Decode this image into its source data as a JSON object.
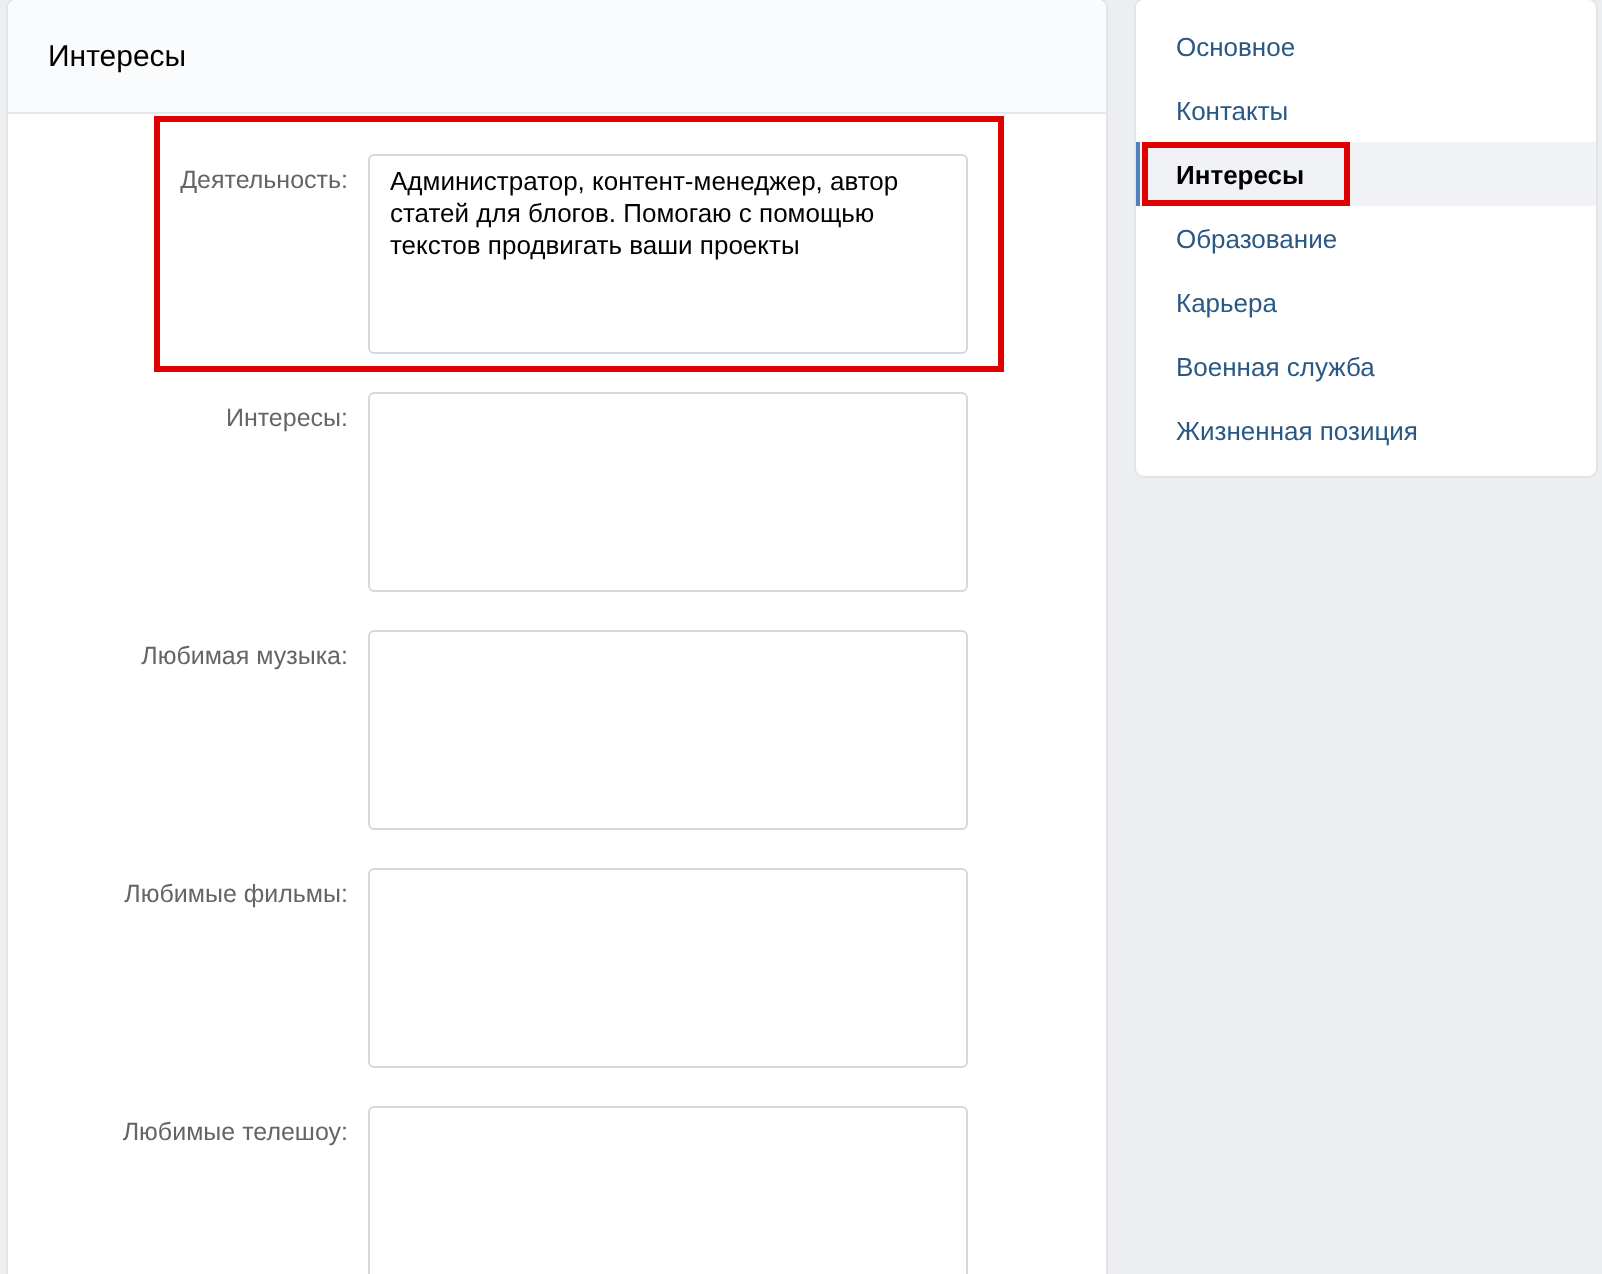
{
  "panel": {
    "title": "Интересы"
  },
  "fields": [
    {
      "label": "Деятельность:",
      "value": "Администратор, контент-менеджер, автор статей для блогов. Помогаю с помощью текстов продвигать ваши проекты",
      "highlighted": true
    },
    {
      "label": "Интересы:",
      "highlighted": false
    },
    {
      "label": "Любимая музыка:",
      "highlighted": false
    },
    {
      "label": "Любимые фильмы:",
      "highlighted": false
    },
    {
      "label": "Любимые телешоу:",
      "highlighted": false
    }
  ],
  "menu": [
    {
      "label": "Основное",
      "selected": false,
      "highlighted": false
    },
    {
      "label": "Контакты",
      "selected": false,
      "highlighted": false
    },
    {
      "label": "Интересы",
      "selected": true,
      "highlighted": true
    },
    {
      "label": "Образование",
      "selected": false,
      "highlighted": false
    },
    {
      "label": "Карьера",
      "selected": false,
      "highlighted": false
    },
    {
      "label": "Военная служба",
      "selected": false,
      "highlighted": false
    },
    {
      "label": "Жизненная позиция",
      "selected": false,
      "highlighted": false
    }
  ]
}
